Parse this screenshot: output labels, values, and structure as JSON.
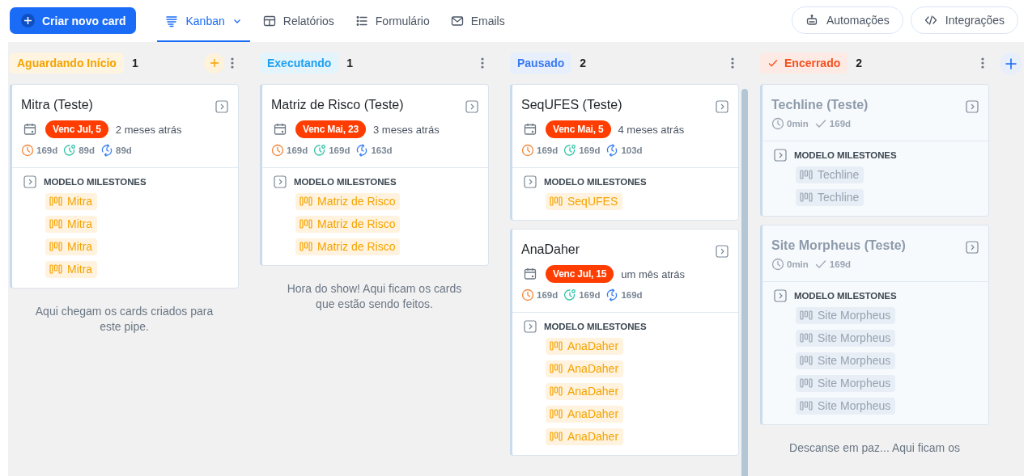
{
  "toolbar": {
    "create_button": "Criar novo card",
    "views": [
      {
        "label": "Kanban",
        "kind": "kanban",
        "selected": true,
        "dropdown": true
      },
      {
        "label": "Relatórios",
        "kind": "table",
        "selected": false,
        "dropdown": false
      },
      {
        "label": "Formulário",
        "kind": "form",
        "selected": false,
        "dropdown": false
      },
      {
        "label": "Emails",
        "kind": "mail",
        "selected": false,
        "dropdown": false
      }
    ],
    "actions": [
      {
        "label": "Automações",
        "kind": "robot"
      },
      {
        "label": "Integrações",
        "kind": "code"
      }
    ]
  },
  "columns": [
    {
      "name": "Aguardando Início",
      "count": "1",
      "color": "#f5a300",
      "done": false,
      "add_button": true,
      "scrollbar": false,
      "footer": "Aqui chegam os cards criados para este pipe.",
      "cards": [
        {
          "title": "Mitra (Teste)",
          "closed": false,
          "due": "Venc Jul, 5",
          "ago": "2 meses atrás",
          "metrics": [
            {
              "kind": "age",
              "value": "169d"
            },
            {
              "kind": "lead",
              "value": "89d"
            },
            {
              "kind": "cycle",
              "value": "89d"
            }
          ],
          "section": "MODELO MILESTONES",
          "tags": [
            "Mitra",
            "Mitra",
            "Mitra",
            "Mitra"
          ]
        }
      ]
    },
    {
      "name": "Executando",
      "count": "1",
      "color": "#1ea0f0",
      "done": false,
      "add_button": false,
      "scrollbar": false,
      "footer": "Hora do show! Aqui ficam os cards que estão sendo feitos.",
      "cards": [
        {
          "title": "Matriz de Risco (Teste)",
          "closed": false,
          "due": "Venc Mai, 23",
          "ago": "3 meses atrás",
          "metrics": [
            {
              "kind": "age",
              "value": "169d"
            },
            {
              "kind": "lead",
              "value": "169d"
            },
            {
              "kind": "cycle",
              "value": "163d"
            }
          ],
          "section": "MODELO MILESTONES",
          "tags": [
            "Matriz de Risco",
            "Matriz de Risco",
            "Matriz de Risco"
          ]
        }
      ]
    },
    {
      "name": "Pausado",
      "count": "2",
      "color": "#3a7af2",
      "done": false,
      "add_button": false,
      "scrollbar": true,
      "cards": [
        {
          "title": "SeqUFES (Teste)",
          "closed": false,
          "due": "Venc Mai, 5",
          "ago": "4 meses atrás",
          "metrics": [
            {
              "kind": "age",
              "value": "169d"
            },
            {
              "kind": "lead",
              "value": "169d"
            },
            {
              "kind": "cycle",
              "value": "103d"
            }
          ],
          "section": "MODELO MILESTONES",
          "tags": [
            "SeqUFES"
          ]
        },
        {
          "title": "AnaDaher",
          "closed": false,
          "due": "Venc Jul, 15",
          "ago": "um mês atrás",
          "metrics": [
            {
              "kind": "age",
              "value": "169d"
            },
            {
              "kind": "lead",
              "value": "169d"
            },
            {
              "kind": "cycle",
              "value": "169d"
            }
          ],
          "section": "MODELO MILESTONES",
          "tags": [
            "AnaDaher",
            "AnaDaher",
            "AnaDaher",
            "AnaDaher",
            "AnaDaher"
          ]
        }
      ]
    },
    {
      "name": "Encerrado",
      "count": "2",
      "color": "#f4511e",
      "done": true,
      "add_button": false,
      "scrollbar": false,
      "footer": "Descanse em paz... Aqui ficam os",
      "cards": [
        {
          "title": "Techline (Teste)",
          "closed": true,
          "metrics": [
            {
              "kind": "age",
              "value": "0min"
            },
            {
              "kind": "done",
              "value": "169d"
            }
          ],
          "section": "MODELO MILESTONES",
          "tags": [
            "Techline",
            "Techline"
          ]
        },
        {
          "title": "Site Morpheus (Teste)",
          "closed": true,
          "metrics": [
            {
              "kind": "age",
              "value": "0min"
            },
            {
              "kind": "done",
              "value": "169d"
            }
          ],
          "section": "MODELO MILESTONES",
          "tags": [
            "Site Morpheus",
            "Site Morpheus",
            "Site Morpheus",
            "Site Morpheus",
            "Site Morpheus"
          ]
        }
      ]
    }
  ]
}
